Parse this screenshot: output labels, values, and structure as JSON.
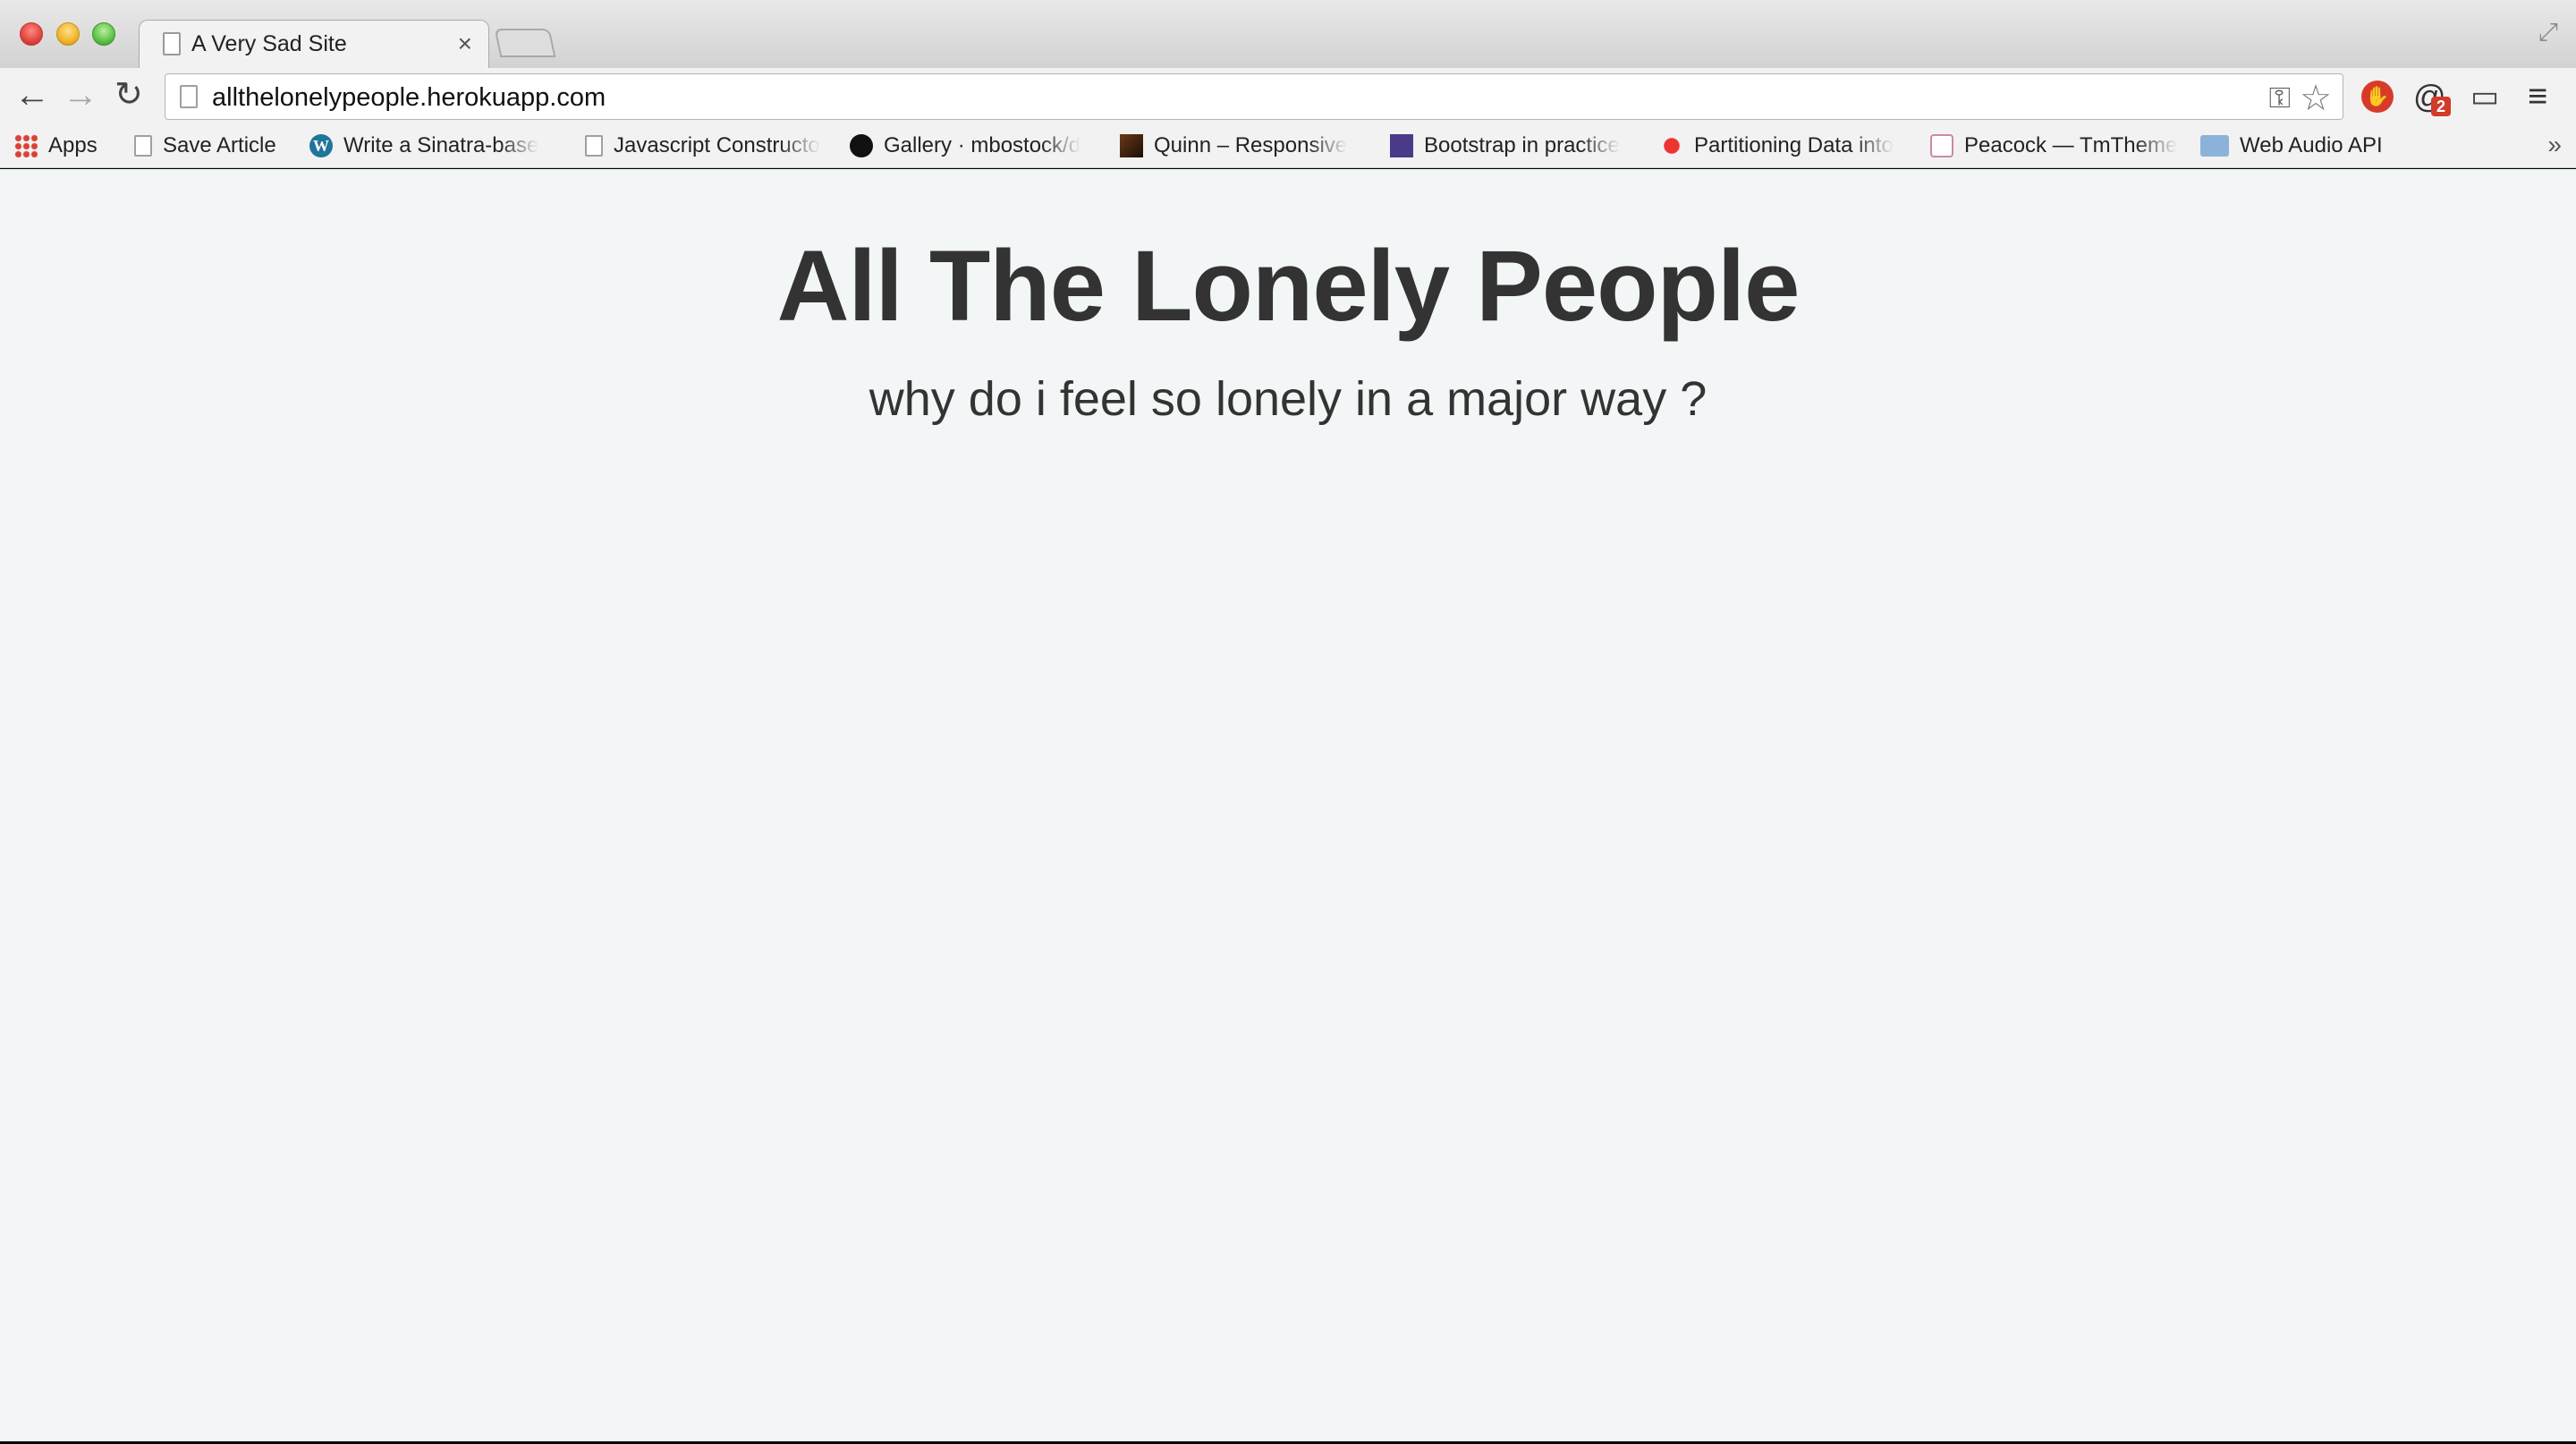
{
  "browser": {
    "tab": {
      "title": "A Very Sad Site",
      "close_glyph": "×"
    },
    "toolbar": {
      "back_glyph": "←",
      "forward_glyph": "→",
      "reload_glyph": "↻",
      "url": "allthelonelypeople.herokuapp.com",
      "key_glyph": "⚿",
      "star_glyph": "☆",
      "mail_badge": "2",
      "adblock_glyph": "✋",
      "mail_glyph": "@",
      "cast_glyph": "▭",
      "menu_glyph": "≡"
    },
    "bookmarks": [
      {
        "label": "Apps",
        "icon": "apps-icon"
      },
      {
        "label": "Save Article",
        "icon": "page-icon"
      },
      {
        "label": "Write a Sinatra-base",
        "icon": "wordpress-icon"
      },
      {
        "label": "Javascript Constructo",
        "icon": "page-icon"
      },
      {
        "label": "Gallery · mbostock/d",
        "icon": "github-icon"
      },
      {
        "label": "Quinn – Responsive",
        "icon": "quinn-icon"
      },
      {
        "label": "Bootstrap in practice",
        "icon": "bootstrap-icon"
      },
      {
        "label": "Partitioning Data into",
        "icon": "partition-icon"
      },
      {
        "label": "Peacock — TmTheme",
        "icon": "peacock-icon"
      },
      {
        "label": "Web Audio API",
        "icon": "folder-icon"
      }
    ],
    "bookmarks_more_glyph": "»"
  },
  "page": {
    "heading": "All The Lonely People",
    "subheading": "why do i feel so lonely in a major way ?"
  },
  "colors": {
    "page_background": "#f3f6f6",
    "text": "#333333",
    "chrome": "#f2f2f2"
  }
}
